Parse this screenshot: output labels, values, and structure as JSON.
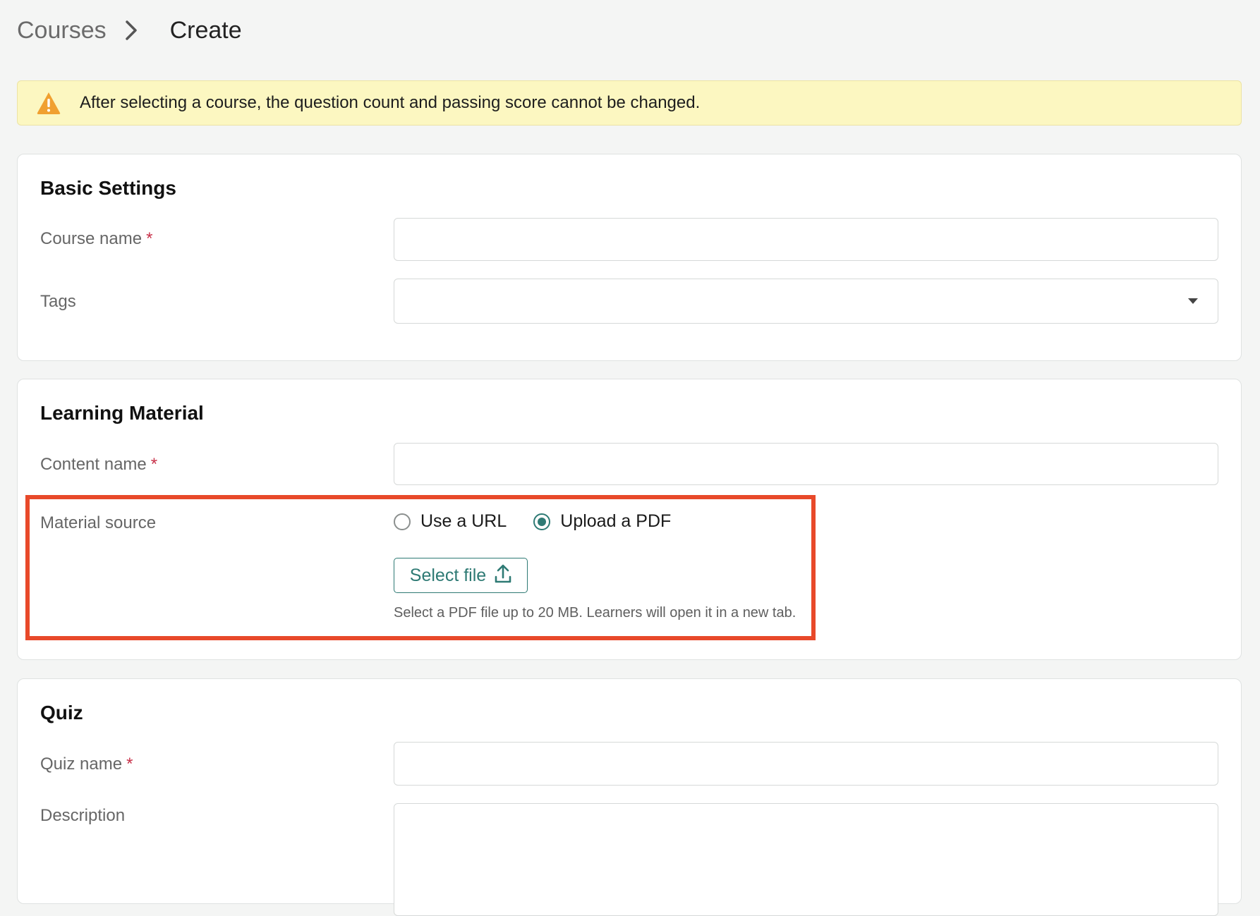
{
  "breadcrumb": {
    "parent": "Courses",
    "current": "Create"
  },
  "alert": {
    "text": "After selecting a course, the question count and passing score cannot be changed."
  },
  "basic_settings": {
    "title": "Basic Settings",
    "course_name_label": "Course name",
    "tags_label": "Tags",
    "required_mark": "*"
  },
  "learning_material": {
    "title": "Learning Material",
    "content_name_label": "Content name",
    "material_source_label": "Material source",
    "options": [
      {
        "label": "Use a URL",
        "selected": false
      },
      {
        "label": "Upload a PDF",
        "selected": true
      }
    ],
    "select_file_label": "Select file",
    "hint": "Select a PDF file up to 20 MB. Learners will open it in a new tab.",
    "required_mark": "*"
  },
  "quiz": {
    "title": "Quiz",
    "quiz_name_label": "Quiz name",
    "description_label": "Description",
    "required_mark": "*"
  },
  "colors": {
    "accent": "#2e7a74",
    "highlight": "#e8492a",
    "alert_bg": "#fcf7c1",
    "warning": "#f0a030"
  }
}
